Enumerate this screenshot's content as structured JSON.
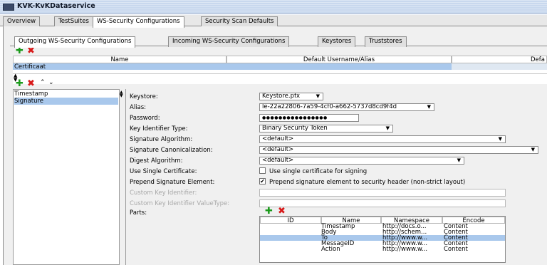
{
  "window": {
    "title": "KVK-KvKDataservice"
  },
  "main_tabs": [
    "Overview",
    "TestSuites",
    "WS-Security Configurations",
    "Security Scan Defaults"
  ],
  "sub_tabs": [
    "Outgoing WS-Security Configurations",
    "Incoming WS-Security Configurations",
    "Keystores",
    "Truststores"
  ],
  "config_table": {
    "headers": [
      "Name",
      "Default Username/Alias",
      "Defa"
    ],
    "rows": [
      "Certificaat"
    ]
  },
  "entries": [
    "Timestamp",
    "Signature"
  ],
  "form": {
    "keystore": {
      "label": "Keystore:",
      "value": "Keystore.pfx"
    },
    "alias": {
      "label": "Alias:",
      "value": "le-22a22806-7a59-4cf0-a662-5737d8cd9f4d"
    },
    "password": {
      "label": "Password:",
      "value": "●●●●●●●●●●●●●●●●"
    },
    "key_identifier_type": {
      "label": "Key Identifier Type:",
      "value": "Binary Security Token"
    },
    "signature_algorithm": {
      "label": "Signature Algorithm:",
      "value": "<default>"
    },
    "signature_canonicalization": {
      "label": "Signature Canonicalization:",
      "value": "<default>"
    },
    "digest_algorithm": {
      "label": "Digest Algorithm:",
      "value": "<default>"
    },
    "use_single_certificate": {
      "label": "Use Single Certificate:",
      "text": "Use single certificate for signing",
      "checked": false
    },
    "prepend_signature_element": {
      "label": "Prepend Signature Element:",
      "text": "Prepend signature element to security header (non-strict layout)",
      "checked": true
    },
    "custom_key_identifier": {
      "label": "Custom Key Identifier:"
    },
    "custom_key_identifier_valuetype": {
      "label": "Custom Key Identifier ValueType:"
    },
    "parts_label": "Parts:"
  },
  "parts_table": {
    "headers": [
      "ID",
      "Name",
      "Namespace",
      "Encode"
    ],
    "rows": [
      [
        "",
        "Timestamp",
        "http://docs.o...",
        "Content"
      ],
      [
        "",
        "Body",
        "http://schem...",
        "Content"
      ],
      [
        "",
        "To",
        "http://www.w...",
        "Content"
      ],
      [
        "",
        "MessageID",
        "http://www.w...",
        "Content"
      ],
      [
        "",
        "Action",
        "http://www.w...",
        "Content"
      ]
    ],
    "selected_row": 2
  },
  "colors": {
    "selection": "#a9c8ec",
    "add": "#1a9a1a",
    "remove": "#d81818"
  }
}
